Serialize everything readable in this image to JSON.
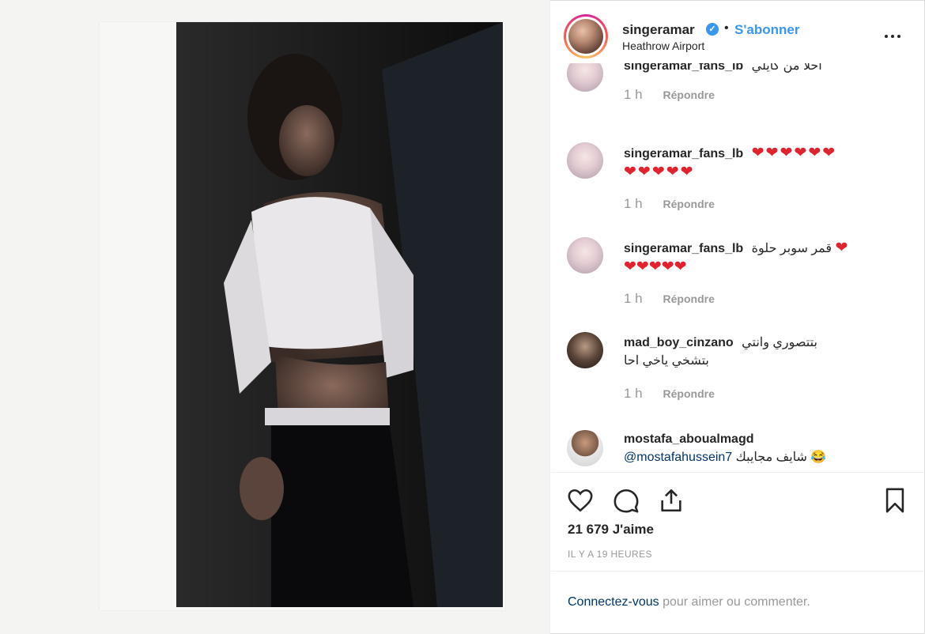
{
  "header": {
    "username": "singeramar",
    "verified_icon": "verified-badge-icon",
    "dot": "•",
    "follow_label": "S'abonner",
    "location": "Heathrow Airport"
  },
  "comments": [
    {
      "user": "singeramar_fans_lb",
      "text": "احلا من كايلي",
      "hearts": "",
      "hearts2": "",
      "time": "1 h",
      "reply": "Répondre"
    },
    {
      "user": "singeramar_fans_lb",
      "text": "",
      "hearts": "❤❤❤❤❤❤",
      "hearts2": "❤❤❤❤❤",
      "time": "1 h",
      "reply": "Répondre"
    },
    {
      "user": "singeramar_fans_lb",
      "text": "قمر سوبر حلوة",
      "hearts": "❤",
      "hearts2": "❤❤❤❤❤",
      "time": "1 h",
      "reply": "Répondre"
    },
    {
      "user": "mad_boy_cinzano",
      "text": "بتتصوري وانتي",
      "text2": "بتشخي ياخي احا",
      "time": "1 h",
      "reply": "Répondre"
    },
    {
      "user": "mostafa_aboualmagd",
      "mention": "@mostafahussein7",
      "text": "شايف مجايبك",
      "emoji": "😂"
    }
  ],
  "actions": {
    "like_icon": "heart-outline-icon",
    "comment_icon": "comment-bubble-icon",
    "share_icon": "share-icon",
    "save_icon": "bookmark-icon"
  },
  "likes_text": "21 679 J'aime",
  "time_ago": "IL Y A 19 HEURES",
  "login": {
    "link": "Connectez-vous",
    "rest": " pour aimer ou commenter."
  },
  "colors": {
    "accent": "#3897f0",
    "muted": "#999999",
    "heart": "#e0232e",
    "link_dark": "#003569"
  }
}
